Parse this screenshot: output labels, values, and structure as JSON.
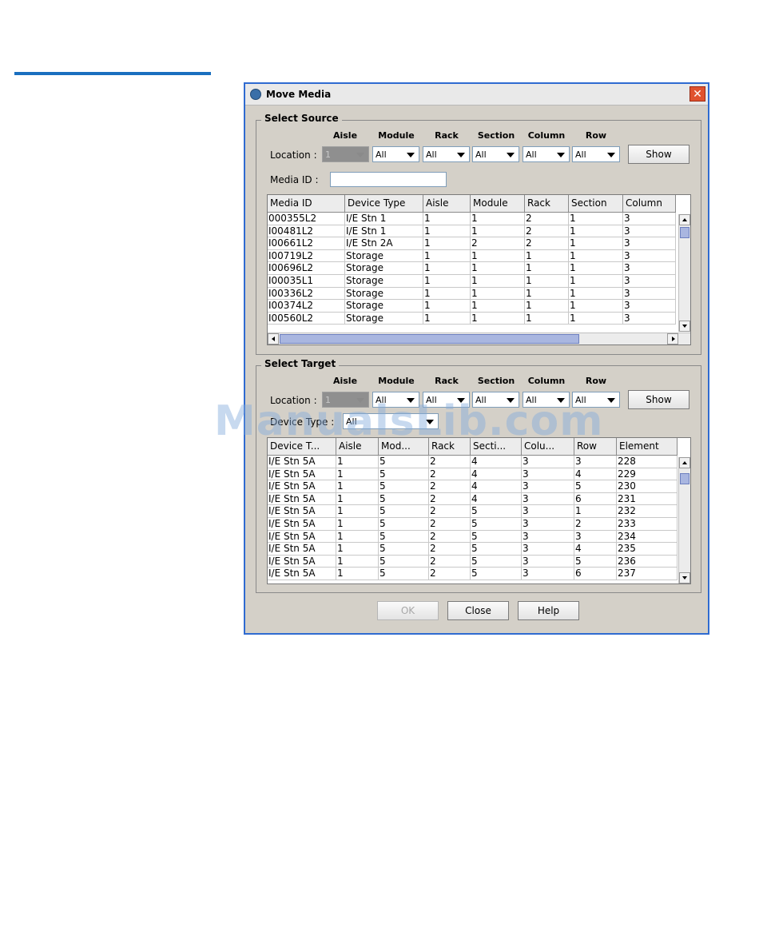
{
  "dialog": {
    "title": "Move Media",
    "close_glyph": "✕"
  },
  "source": {
    "group_title": "Select Source",
    "headers": [
      "Aisle",
      "Module",
      "Rack",
      "Section",
      "Column",
      "Row"
    ],
    "location_label": "Location :",
    "aisle_value": "1",
    "module_value": "All",
    "rack_value": "All",
    "section_value": "All",
    "column_value": "All",
    "row_value": "All",
    "show_label": "Show",
    "media_id_label": "Media ID :",
    "media_id_value": "",
    "table": {
      "columns": [
        "Media ID",
        "Device Type",
        "Aisle",
        "Module",
        "Rack",
        "Section",
        "Column"
      ],
      "rows": [
        [
          "000355L2",
          "I/E Stn 1",
          "1",
          "1",
          "2",
          "1",
          "3"
        ],
        [
          "I00481L2",
          "I/E Stn 1",
          "1",
          "1",
          "2",
          "1",
          "3"
        ],
        [
          "I00661L2",
          "I/E Stn 2A",
          "1",
          "2",
          "2",
          "1",
          "3"
        ],
        [
          "I00719L2",
          "Storage",
          "1",
          "1",
          "1",
          "1",
          "3"
        ],
        [
          "I00696L2",
          "Storage",
          "1",
          "1",
          "1",
          "1",
          "3"
        ],
        [
          "I00035L1",
          "Storage",
          "1",
          "1",
          "1",
          "1",
          "3"
        ],
        [
          "I00336L2",
          "Storage",
          "1",
          "1",
          "1",
          "1",
          "3"
        ],
        [
          "I00374L2",
          "Storage",
          "1",
          "1",
          "1",
          "1",
          "3"
        ],
        [
          "I00560L2",
          "Storage",
          "1",
          "1",
          "1",
          "1",
          "3"
        ]
      ]
    }
  },
  "target": {
    "group_title": "Select Target",
    "headers": [
      "Aisle",
      "Module",
      "Rack",
      "Section",
      "Column",
      "Row"
    ],
    "location_label": "Location :",
    "aisle_value": "1",
    "module_value": "All",
    "rack_value": "All",
    "section_value": "All",
    "column_value": "All",
    "row_value": "All",
    "show_label": "Show",
    "device_type_label": "Device Type :",
    "device_type_value": "All",
    "table": {
      "columns": [
        "Device T...",
        "Aisle",
        "Mod...",
        "Rack",
        "Secti...",
        "Colu...",
        "Row",
        "Element"
      ],
      "rows": [
        [
          "I/E Stn 5A",
          "1",
          "5",
          "2",
          "4",
          "3",
          "3",
          "228"
        ],
        [
          "I/E Stn 5A",
          "1",
          "5",
          "2",
          "4",
          "3",
          "4",
          "229"
        ],
        [
          "I/E Stn 5A",
          "1",
          "5",
          "2",
          "4",
          "3",
          "5",
          "230"
        ],
        [
          "I/E Stn 5A",
          "1",
          "5",
          "2",
          "4",
          "3",
          "6",
          "231"
        ],
        [
          "I/E Stn 5A",
          "1",
          "5",
          "2",
          "5",
          "3",
          "1",
          "232"
        ],
        [
          "I/E Stn 5A",
          "1",
          "5",
          "2",
          "5",
          "3",
          "2",
          "233"
        ],
        [
          "I/E Stn 5A",
          "1",
          "5",
          "2",
          "5",
          "3",
          "3",
          "234"
        ],
        [
          "I/E Stn 5A",
          "1",
          "5",
          "2",
          "5",
          "3",
          "4",
          "235"
        ],
        [
          "I/E Stn 5A",
          "1",
          "5",
          "2",
          "5",
          "3",
          "5",
          "236"
        ],
        [
          "I/E Stn 5A",
          "1",
          "5",
          "2",
          "5",
          "3",
          "6",
          "237"
        ]
      ]
    }
  },
  "footer": {
    "ok_label": "OK",
    "close_label": "Close",
    "help_label": "Help"
  },
  "watermark": "ManualsLib.com"
}
